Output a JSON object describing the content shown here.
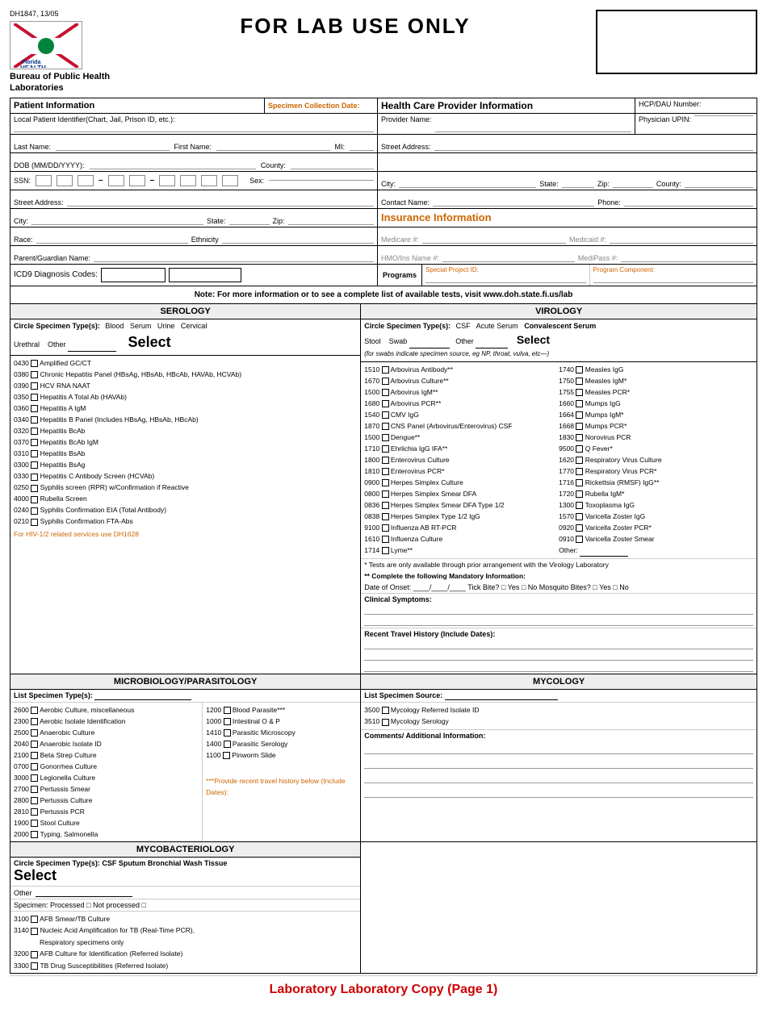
{
  "header": {
    "form_num": "DH1847, 13/05",
    "title": "FOR LAB USE ONLY",
    "bureau": "Bureau of Public Health Laboratories",
    "logo_text": "Florida HEALTH"
  },
  "top_row": {
    "patient_info_label": "Patient Information",
    "specimen_date_label": "Specimen Collection Date:",
    "hcp_label": "Health Care Provider Information",
    "hcp_num_label": "HCP/DAU Number:"
  },
  "patient": {
    "local_id_label": "Local Patient Identifier(Chart, Jail, Prison ID, etc.):",
    "provider_label": "Provider Name:",
    "physician_label": "Physician UPIN:",
    "last_name_label": "Last Name:",
    "first_name_label": "First Name:",
    "mi_label": "MI:",
    "street_address_label": "Street Address:",
    "dob_label": "DOB (MM/DD/YYYY):",
    "county_label": "County:",
    "ssn_label": "SSN:",
    "sex_label": "Sex:",
    "city_label": "City:",
    "state_label": "State:",
    "zip_label": "Zip:",
    "county2_label": "County:",
    "street_label": "Street Address:",
    "contact_label": "Contact Name:",
    "phone_label": "Phone:",
    "city2_label": "City:",
    "state2_label": "State:",
    "zip2_label": "Zip:",
    "race_label": "Race:",
    "ethnicity_label": "Ethnicity",
    "parent_label": "Parent/Guardian Name:",
    "icd_label": "ICD9 Diagnosis Codes:",
    "insurance_title": "Insurance Information",
    "medicare_label": "Medicare #:",
    "medicaid_label": "Medicaid #:",
    "hmo_label": "HMO/Ins Name #:",
    "medipass_label": "MediPass #:",
    "programs_label": "Programs",
    "special_project_label": "Special Project ID:",
    "program_component_label": "Program Component:"
  },
  "note": {
    "text": "Note: For more information or to see a complete list of available tests, visit www.doh.state.fi.us/lab"
  },
  "serology": {
    "header": "SEROLOGY",
    "specimen_label": "Circle Specimen Type(s):",
    "types": "Blood   Serum   Urine   Cervical",
    "urethral": "Urethral",
    "other": "Other",
    "select": "Select",
    "tests": [
      "0430 □ Amplified GC/CT",
      "0380 □ Chronic Hepatitis Panel (HBsAg, HBsAb, HBcAb, HAVAb, HCVAb)",
      "0390 □ HCV RNA NAAT",
      "0350 □ Hepatitis A Total Ab (HAVAb)",
      "0360 □ Hepatitis A IgM",
      "0340 □ Hepatitis B Panel (Includes HBsAg, HBsAb, HBcAb)",
      "0320 □ Hepatitis BcAb",
      "0370 □ Hepatitis BcAb IgM",
      "0310 □ Hepatitis BsAb",
      "0300 □ Hepatitis BsAg",
      "0330 □ Hepatitis C Antibody Screen (HCVAb)",
      "0250 □ Syphilis screen (RPR) w/Confirmation if Reactive",
      "4000 □ Rubella Screen",
      "0240 □ Syphilis Confirmation EIA (Total Antibody)",
      "0210 □ Syphilis Confirmation FTA-Abs"
    ],
    "hiv_note": "For HIV-1/2 related services use DH1628"
  },
  "virology": {
    "header": "VIROLOGY",
    "specimen_label": "Circle Specimen Type(s):",
    "types": "CSF   Acute Serum   Convalescent Serum",
    "stool": "Stool",
    "swab": "Swab",
    "other": "Other",
    "select": "Select",
    "swab_note": "(for swabs indicate specimen source, eg NP, throat, vulva, etc—)",
    "col1_tests": [
      "1510 □ Arbovirus Antibody**",
      "1670 □ Arbovirus Culture**",
      "1500 □ Arbovirus IgM**",
      "1680 □ Arbovirus PCR**",
      "1540 □ CMV IgG",
      "1870 □ CNS Panel (Arbovirus/Enterovirus) CSF",
      "1500 □ Dengue**",
      "1710 □ Ehrlichia IgG IFA**",
      "1800 □ Enterovirus Culture",
      "1810 □ Enterovirus PCR*",
      "0900 □ Herpes Simplex Culture",
      "0800 □ Herpes Simplex Smear DFA",
      "0836 □ Herpes Simplex Smear DFA Type 1/2",
      "0838 □ Herpes Simplex Type 1/2 IgG",
      "9100 □ Influenza AB RT-PCR",
      "1610 □ Influenza Culture",
      "1714 □ Lyme**"
    ],
    "col2_tests": [
      "1740 □ Measles IgG",
      "1750 □ Measles IgM*",
      "1755 □ Measles PCR*",
      "1660 □ Mumps IgG",
      "1664 □ Mumps IgM*",
      "1668 □ Mumps PCR*",
      "1830 □ Norovirus PCR",
      "9500 □ Q Fever*",
      "1620 □ Respiratory Virus Culture",
      "1770 □ Respiratory Virus PCR*",
      "1716 □ Rickettsia (RMSF) IgG**",
      "1720 □ Rubella IgM*",
      "1300 □ Toxoplasma IgG",
      "1570 □ Varicella Zoster IgG",
      "0920 □ Varicella Zoster PCR*",
      "0910 □ Varicella Zoster Smear",
      "Other: _________"
    ],
    "asterisk_note": "* Tests are only available through prior arrangement with the Virology Laboratory",
    "mandatory_note": "** Complete the following Mandatory Information:",
    "date_onset": "Date of Onset: ____/____/____  Tick Bite? □ Yes □ No Mosquito Bites? □ Yes □ No",
    "clinical_label": "Clinical Symptoms:",
    "travel_label": "Recent Travel History (Include Dates):"
  },
  "microbiology": {
    "header": "MICROBIOLOGY/PARASITOLOGY",
    "list_label": "List Specimen Type(s):",
    "col1": [
      "2600 □ Aerobic Culture, miscellaneous",
      "2300 □ Aerobic Isolate Identification",
      "2500 □ Anaerobic Culture",
      "2040 □ Anaerobic Isolate ID",
      "2100 □ Beta Strep Culture",
      "0700 □ Gonorrhea Culture",
      "3000 □ Legionella Culture",
      "2700 □ Pertussis Smear",
      "2800 □ Pertussis Culture",
      "2810 □ Pertussis PCR",
      "1900 □ Stool Culture",
      "2000 □ Typing, Salmonella"
    ],
    "col2": [
      "1200 □ Blood Parasite***",
      "1000 □ Intestinal O & P",
      "1410 □ Parasitic Microscopy",
      "1400 □ Parasitic Serology",
      "1100 □ Pinworm Slide"
    ],
    "travel_note": "***Provide recent travel history below (Include Dates):"
  },
  "mycobacteriology": {
    "header": "MYCOBACTERIOLOGY",
    "specimen_label": "Circle Specimen Type(s): CSF  Sputum  Bronchial Wash  Tissue",
    "select": "Select",
    "other_label": "Other",
    "specimen_processed": "Specimen:  Processed □  Not processed □",
    "tests": [
      "3100 □ AFB Smear/TB Culture",
      "3140 □ Nucleic Acid Amplification for TB (Real-Time PCR),",
      "          Respiratory specimens only",
      "3200 □ AFB Culture for Identification (Referred Isolate)",
      "3300 □ TB Drug Susceptibilities (Referred Isolate)"
    ]
  },
  "mycology": {
    "header": "MYCOLOGY",
    "list_label": "List Specimen Source:",
    "tests": [
      "3500 □ Mycology Referred Isolate ID",
      "3510 □ Mycology Serology"
    ],
    "comments_label": "Comments/ Additional Information:"
  },
  "footer": {
    "text": "Laboratory Copy (Page 1)"
  }
}
